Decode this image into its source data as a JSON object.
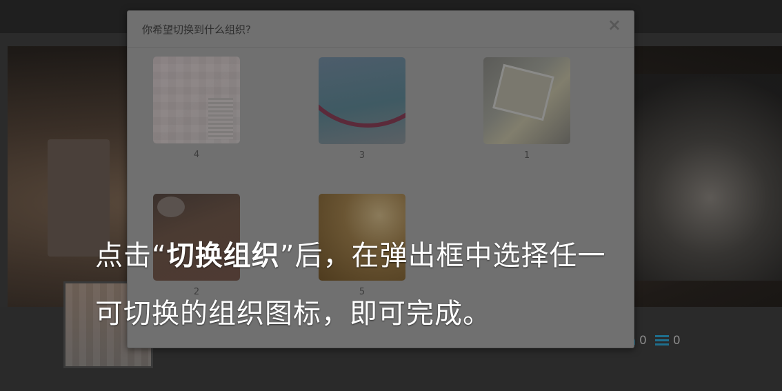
{
  "modal": {
    "title": "你希望切换到什么组织?",
    "close_label": "×"
  },
  "organizations": [
    {
      "label": "4"
    },
    {
      "label": "3"
    },
    {
      "label": "1"
    },
    {
      "label": "2"
    },
    {
      "label": "5"
    }
  ],
  "background_stats": {
    "likes": "0",
    "lists": "0"
  },
  "caption": {
    "line1_prefix": "点击“",
    "line1_bold": "切换组织",
    "line1_suffix": "”后，在弹出框中选择任一",
    "line2": "可切换的组织图标，即可完成。"
  },
  "colors": {
    "icon_accent": "#1e6f8e",
    "modal_bg": "#707070"
  }
}
